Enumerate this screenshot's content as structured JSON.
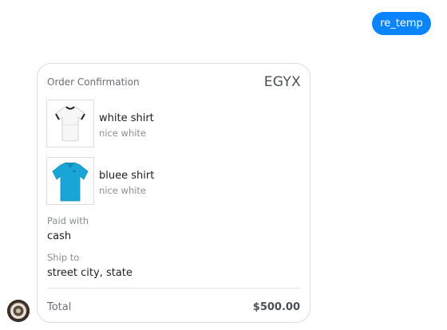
{
  "user_message": {
    "text": "re_temp",
    "color": "#0a84ff"
  },
  "receipt": {
    "title": "Order Confirmation",
    "merchant": "EGYX",
    "items": [
      {
        "name": "white shirt",
        "description": "nice white",
        "image_icon": "white-tshirt-icon",
        "color": "#ffffff"
      },
      {
        "name": "bluee shirt",
        "description": "nice white",
        "image_icon": "blue-tshirt-icon",
        "color": "#19a6d6"
      }
    ],
    "payment": {
      "label": "Paid with",
      "value": "cash"
    },
    "shipping": {
      "label": "Ship to",
      "value": "street city, state"
    },
    "total": {
      "label": "Total",
      "value": "$500.00"
    }
  }
}
